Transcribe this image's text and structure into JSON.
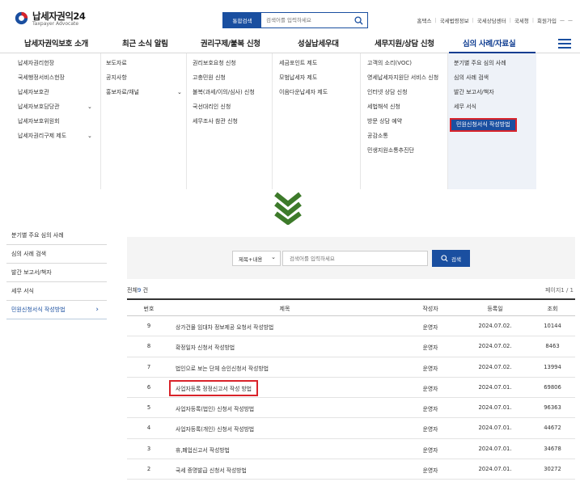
{
  "header": {
    "logo_title": "납세자권익24",
    "logo_subtitle": "Taxpayer Advocate",
    "search_scope": "통합검색",
    "search_placeholder": "검색어를 입력하세요",
    "util_links": [
      "홈택스",
      "국세법령정보",
      "국세상담센터",
      "국세청",
      "회원가입"
    ],
    "zoom": "ㅡ ㅡ"
  },
  "nav": {
    "items": [
      "납세자권익보호 소개",
      "최근 소식 알림",
      "권리구제/불복 신청",
      "성실납세우대",
      "세무지원/상담 신청",
      "심의 사례/자료실"
    ],
    "active_index": 5
  },
  "mega_menu": {
    "col1": [
      "납세자권리헌장",
      "국세행정서비스헌장",
      "납세자보호관",
      "납세자보호담당관",
      "납세자보호위원회",
      "납세자권리구제 제도"
    ],
    "col2": [
      "보도자료",
      "공지사항",
      "홍보자료/채널"
    ],
    "col3": [
      "권리보호요청 신청",
      "고충민원 신청",
      "불복(과세/이의/심사) 신청",
      "국선대리인 신청",
      "세무조사 참관 신청"
    ],
    "col4": [
      "세금포인트 제도",
      "모범납세자 제도",
      "이음다운납세자 제도"
    ],
    "col5": [
      "고객의 소리(VOC)",
      "영세납세자지원단 서비스 신청",
      "인터넷 상담 신청",
      "세법해석 신청",
      "방문 상담 예약",
      "공감소통",
      "민생지원소통추진단"
    ],
    "col6": [
      "분기별 주요 심의 사례",
      "심의 사례 검색",
      "발간 보고서/책자",
      "세무 서식",
      "민원신청서식 작성방법"
    ]
  },
  "sidebar": {
    "items": [
      "분기별 주요 심의 사례",
      "심의 사례 검색",
      "발간 보고서/책자",
      "세무 서식",
      "민원신청서식 작성방법"
    ],
    "active_index": 4
  },
  "board_search": {
    "scope": "제목+내용",
    "placeholder": "검색어를 입력하세요",
    "button": "검색"
  },
  "summary": {
    "total_prefix": "전체",
    "total_count": "9",
    "total_suffix": " 건",
    "page_info": "페이지1 / 1"
  },
  "table": {
    "headers": {
      "no": "번호",
      "title": "제목",
      "author": "작성자",
      "date": "등록일",
      "views": "조회"
    },
    "rows": [
      {
        "no": "9",
        "title": "상가건물 임대차 정보제공 요청서 작성방법",
        "author": "운영자",
        "date": "2024.07.02.",
        "views": "10144"
      },
      {
        "no": "8",
        "title": "확정일자 신청서 작성방법",
        "author": "운영자",
        "date": "2024.07.02.",
        "views": "8463"
      },
      {
        "no": "7",
        "title": "법인으로 보는 단체 승인신청서 작성방법",
        "author": "운영자",
        "date": "2024.07.02.",
        "views": "13994"
      },
      {
        "no": "6",
        "title": "사업자등록 정정신고서 작성 방법",
        "author": "운영자",
        "date": "2024.07.01.",
        "views": "69806"
      },
      {
        "no": "5",
        "title": "사업자등록(법인) 신청서 작성방법",
        "author": "운영자",
        "date": "2024.07.01.",
        "views": "96363"
      },
      {
        "no": "4",
        "title": "사업자등록(개인) 신청서 작성방법",
        "author": "운영자",
        "date": "2024.07.01.",
        "views": "44672"
      },
      {
        "no": "3",
        "title": "휴,폐업신고서 작성방법",
        "author": "운영자",
        "date": "2024.07.01.",
        "views": "34678"
      },
      {
        "no": "2",
        "title": "국세 증명발급 신청서 작성방법",
        "author": "운영자",
        "date": "2024.07.01.",
        "views": "30272"
      }
    ]
  },
  "colors": {
    "brand_blue": "#1a4fa0",
    "highlight_red": "#d9232a",
    "arrow_green": "#3d7a2a"
  }
}
